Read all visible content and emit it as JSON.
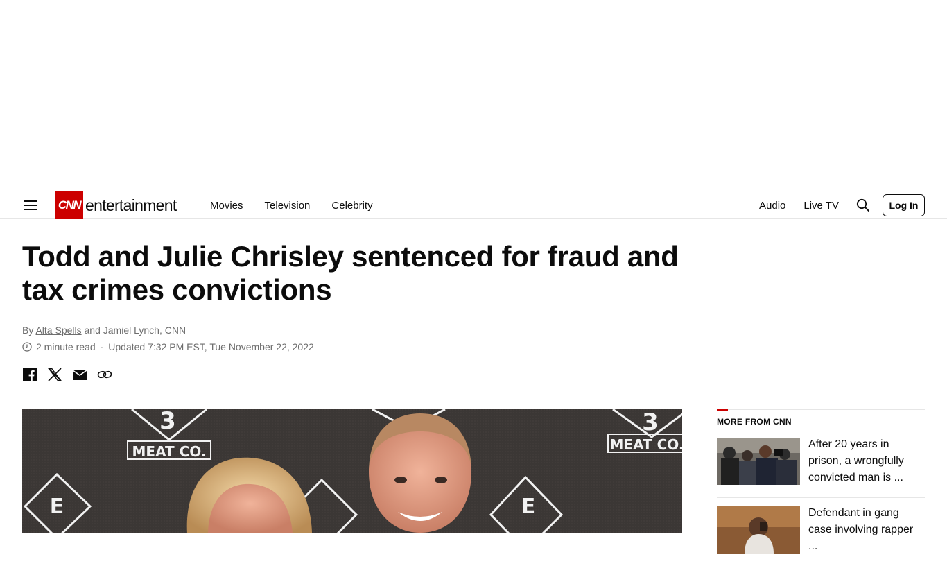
{
  "header": {
    "logo_mark": "CNN",
    "logo_word": "entertainment",
    "nav": [
      "Movies",
      "Television",
      "Celebrity"
    ],
    "right_nav": [
      "Audio",
      "Live TV"
    ],
    "login_label": "Log In"
  },
  "article": {
    "headline": "Todd and Julie Chrisley sentenced for fraud and tax crimes convictions",
    "byline_prefix": "By",
    "author_1": "Alta Spells",
    "byline_rest": "and Jamiel Lynch, CNN",
    "read_time": "2 minute read",
    "separator": "·",
    "updated": "Updated 7:32 PM EST, Tue November 22, 2022",
    "share_icons": [
      "facebook-icon",
      "x-icon",
      "email-icon",
      "link-icon"
    ]
  },
  "hero": {
    "backdrop_text": "MEAT CO."
  },
  "sidebar": {
    "title": "MORE FROM CNN",
    "stories": [
      {
        "text": "After 20 years in prison, a wrongfully convicted man is ..."
      },
      {
        "text": "Defendant in gang case involving rapper ..."
      }
    ]
  },
  "colors": {
    "brand_red": "#cc0000",
    "text": "#0c0c0c",
    "muted": "#6e6e6e"
  }
}
